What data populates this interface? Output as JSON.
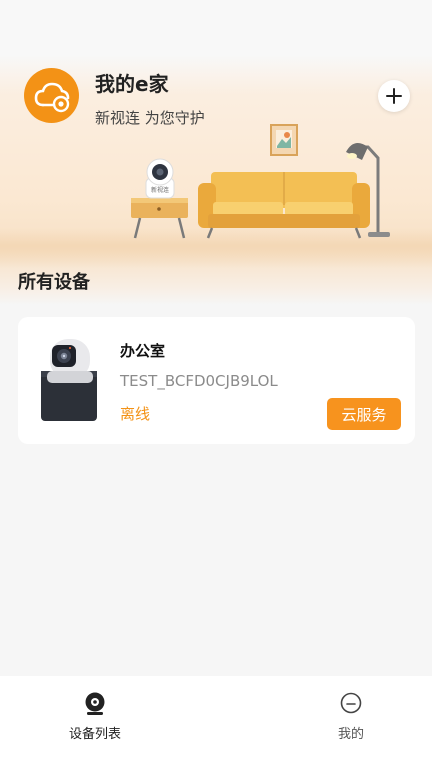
{
  "header": {
    "title": "我的e家",
    "subtitle": "新视连 为您守护",
    "logo_icon": "cloud-camera-icon",
    "add_icon": "plus-icon"
  },
  "scene": {
    "camera_badge": "新视连"
  },
  "devices_section": {
    "title": "所有设备"
  },
  "devices": [
    {
      "name": "办公室",
      "id": "TEST_BCFD0CJB9LOL",
      "status": "离线",
      "cloud_button": "云服务"
    }
  ],
  "tabbar": {
    "items": [
      {
        "label": "设备列表",
        "icon": "camera-icon",
        "active": true
      },
      {
        "label": "我的",
        "icon": "user-face-icon",
        "active": false
      }
    ]
  },
  "colors": {
    "accent": "#f39216",
    "background": "#f6f6f6",
    "card": "#ffffff"
  }
}
